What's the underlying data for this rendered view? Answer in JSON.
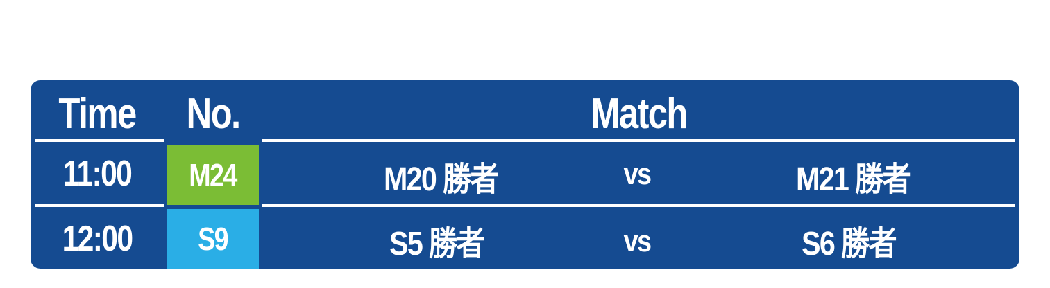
{
  "colors": {
    "panel_bg": "#154b91",
    "rule": "#ffffff",
    "text": "#ffffff"
  },
  "header": {
    "time": "Time",
    "no": "No.",
    "match": "Match"
  },
  "rows": [
    {
      "time": "11:00",
      "no": "M24",
      "no_color": "#7bbd35",
      "team_a": "M20 勝者",
      "vs": "vs",
      "team_b": "M21 勝者"
    },
    {
      "time": "12:00",
      "no": "S9",
      "no_color": "#2aaee6",
      "team_a": "S5 勝者",
      "vs": "vs",
      "team_b": "S6 勝者"
    }
  ]
}
